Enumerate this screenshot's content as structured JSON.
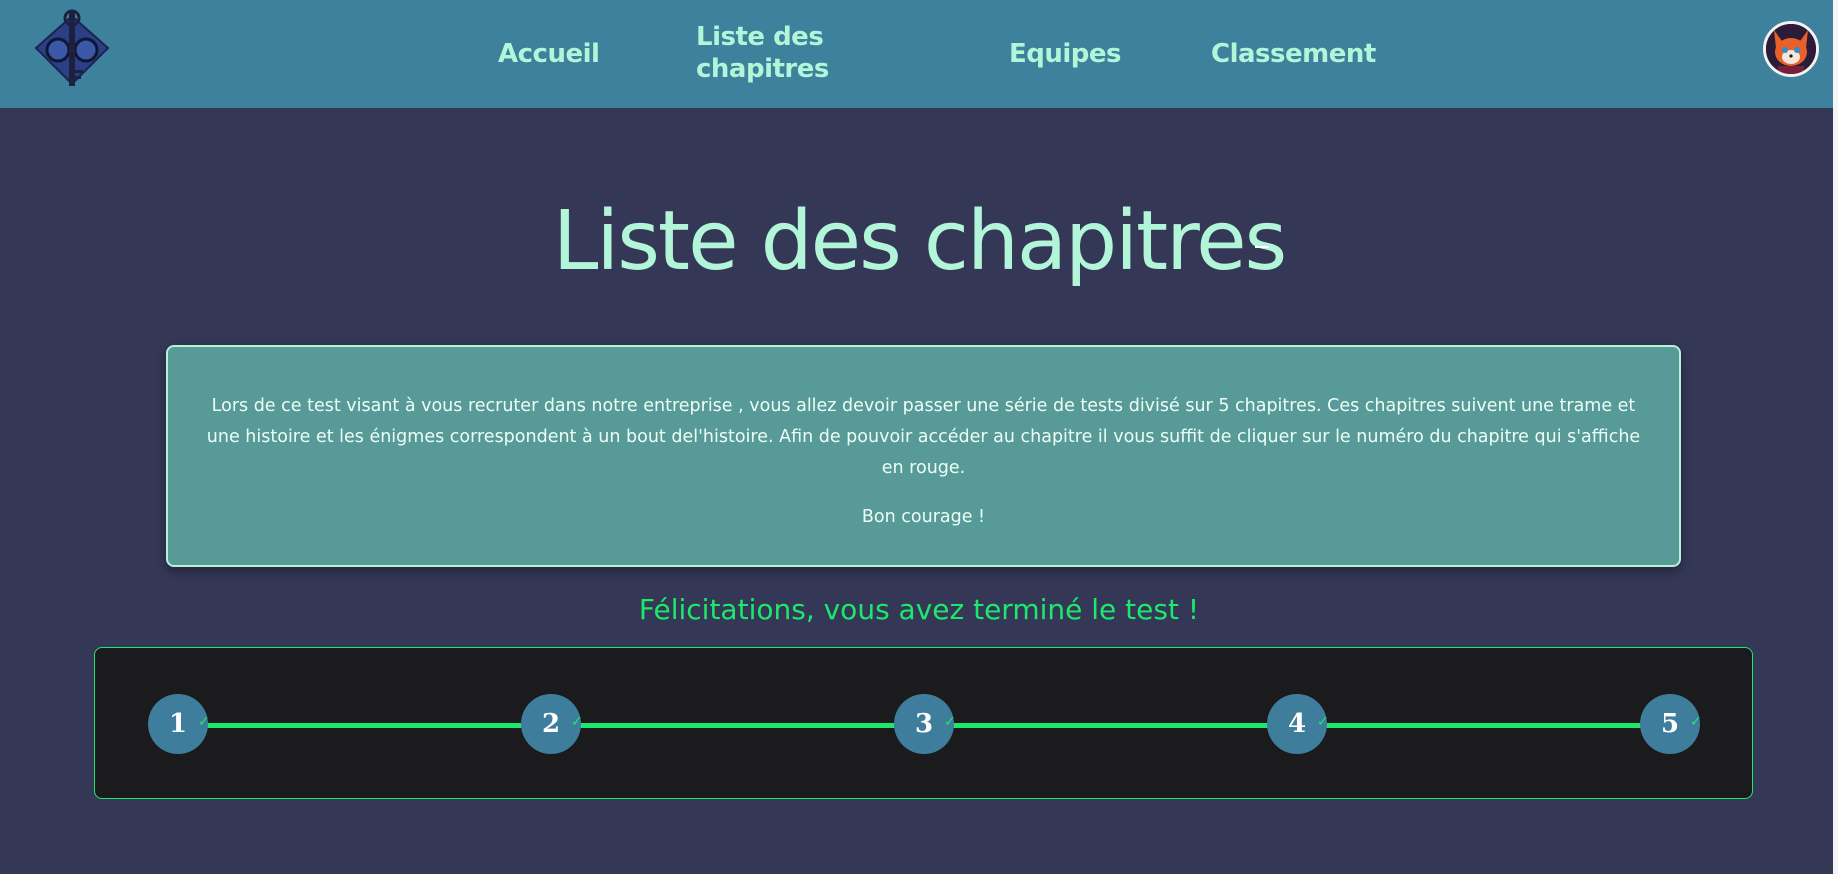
{
  "nav": {
    "home": "Accueil",
    "chapters": "Liste des chapitres",
    "teams": "Equipes",
    "ranking": "Classement"
  },
  "page": {
    "title": "Liste des chapitres"
  },
  "intro": {
    "text": "Lors de ce test visant à vous recruter dans notre entreprise , vous allez devoir passer une série de tests divisé sur 5 chapitres. Ces chapitres suivent une trame et une histoire et les énigmes correspondent à un bout del'histoire. Afin de pouvoir accéder au chapitre il vous suffit de cliquer sur le numéro du chapitre qui s'affiche en rouge.",
    "cheer": "Bon courage !"
  },
  "status": {
    "message": "Félicitations, vous avez terminé le test !"
  },
  "progress": {
    "steps": [
      {
        "number": "1",
        "done_mark": "✓"
      },
      {
        "number": "2",
        "done_mark": "✓"
      },
      {
        "number": "3",
        "done_mark": "✓"
      },
      {
        "number": "4",
        "done_mark": "✓"
      },
      {
        "number": "5",
        "done_mark": "✓"
      }
    ]
  },
  "icons": {
    "logo": "key-logo-icon",
    "avatar": "red-panda-avatar",
    "check": "check-icon"
  },
  "colors": {
    "header_bg": "#3e819d",
    "page_bg": "#343756",
    "nav_text": "#b2f5d8",
    "info_bg": "#589a98",
    "success": "#1de86b",
    "step_bg": "#3e7e9c",
    "panel_bg": "#1b1b1d"
  }
}
